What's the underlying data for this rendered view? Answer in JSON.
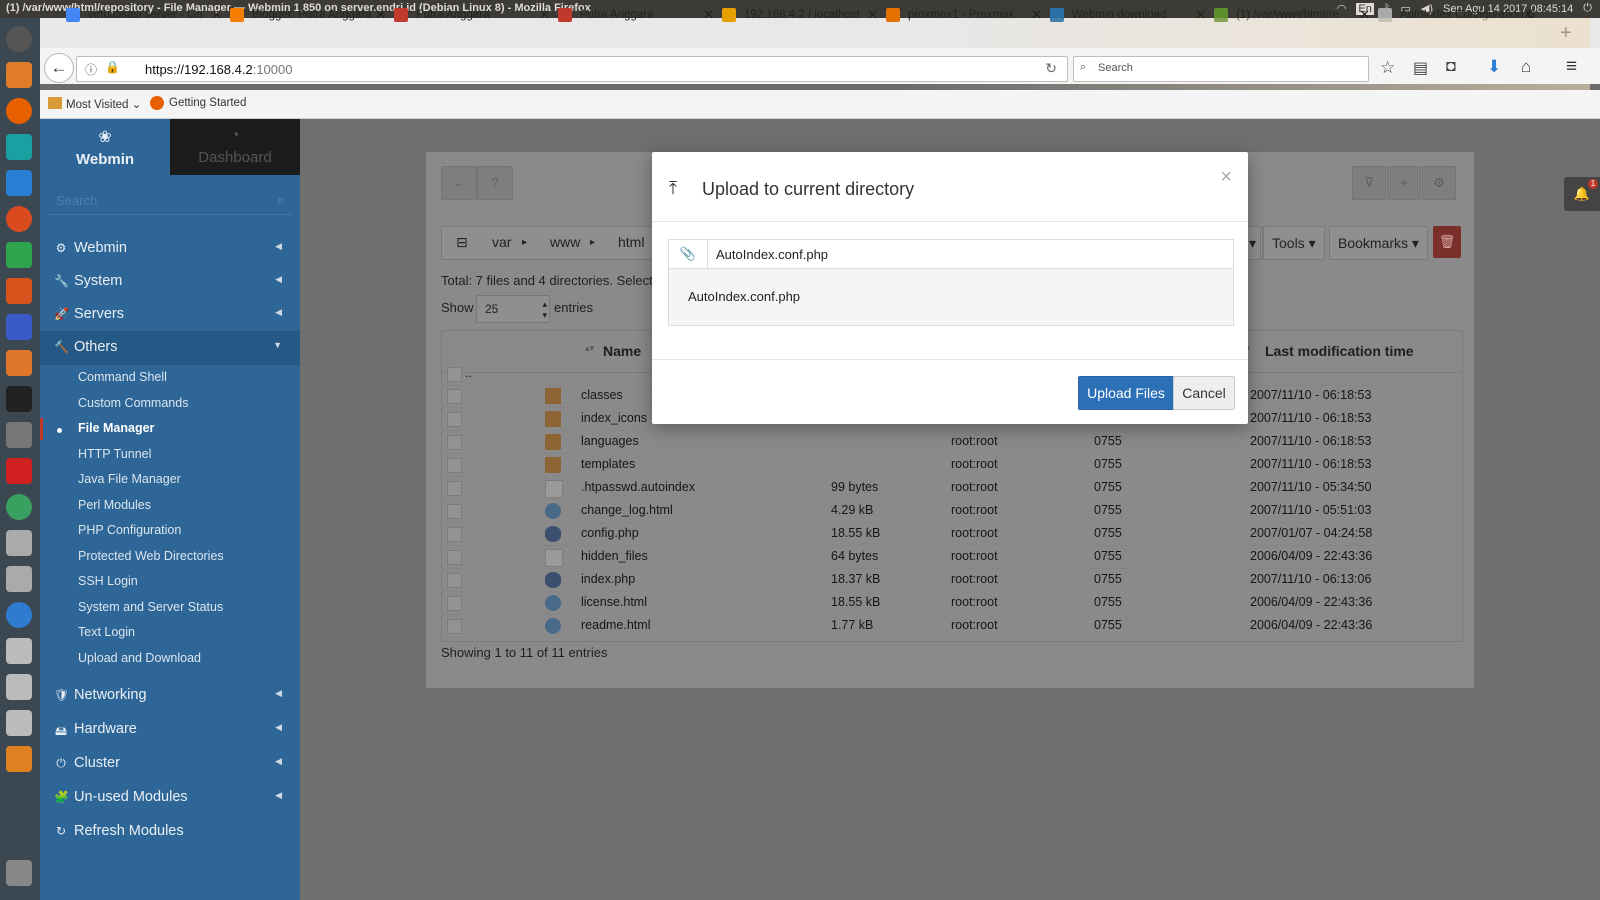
{
  "os": {
    "window_title": "(1) /var/www/html/repository - File Manager — Webmin 1.850 on server.endri.id (Debian Linux 8) - Mozilla Firefox",
    "keyboard": "En",
    "datetime": "Sen Agu 14 2017 08:45:14"
  },
  "browser": {
    "tabs": [
      {
        "label": "virtualisasi server - Go",
        "icon": "google-icon",
        "icolor": "#4285f4"
      },
      {
        "label": "Blogger: Putra Anggara",
        "icon": "blogger-icon",
        "icolor": "#f57d00"
      },
      {
        "label": "Putra Anggara",
        "icon": "putra-icon",
        "icolor": "#c0392b"
      },
      {
        "label": "Putra Anggara",
        "icon": "putra-icon",
        "icolor": "#c0392b"
      },
      {
        "label": "192.168.4.2 / localhost",
        "icon": "pma-icon",
        "icolor": "#e6a000"
      },
      {
        "label": "proxmox1 - Proxmox",
        "icon": "proxmox-icon",
        "icolor": "#e57000"
      },
      {
        "label": "Webmin download",
        "icon": "sf-icon",
        "icolor": "#2970a6"
      },
      {
        "label": "(1) /var/www/html/re",
        "icon": "webmin-icon",
        "icolor": "#5a8f2c"
      },
      {
        "label": "AutoIndex Configuration G",
        "icon": "page-icon",
        "icolor": "#aaa"
      }
    ],
    "url_host": "https://192.168.4.2",
    "url_rest": ":10000",
    "search_placeholder": "Search",
    "bookmarks": [
      "Most Visited",
      "Getting Started"
    ]
  },
  "sidebar": {
    "tab_webmin": "Webmin",
    "tab_dashboard": "Dashboard",
    "search_placeholder": "Search",
    "categories_top": [
      "Webmin",
      "System",
      "Servers",
      "Others"
    ],
    "others_items": [
      "Command Shell",
      "Custom Commands",
      "File Manager",
      "HTTP Tunnel",
      "Java File Manager",
      "Perl Modules",
      "PHP Configuration",
      "Protected Web Directories",
      "SSH Login",
      "System and Server Status",
      "Text Login",
      "Upload and Download"
    ],
    "categories_bottom": [
      "Networking",
      "Hardware",
      "Cluster",
      "Un-used Modules",
      "Refresh Modules"
    ]
  },
  "filemanager": {
    "breadcrumb": [
      "var",
      "www",
      "html"
    ],
    "tools_label": "Tools",
    "bookmarks_label": "Bookmarks",
    "summary": "Total: 7 files and 4 directories. Select",
    "show_label": "Show",
    "entries_value": "25",
    "entries_label": "entries",
    "col_name": "Name",
    "col_time": "Last modification time",
    "parent": "..",
    "rows": [
      {
        "name": "classes",
        "size": "",
        "owner": "",
        "perm": "",
        "time": "2007/11/10 - 06:18:53",
        "type": "folder"
      },
      {
        "name": "index_icons",
        "size": "",
        "owner": "",
        "perm": "",
        "time": "2007/11/10 - 06:18:53",
        "type": "folder"
      },
      {
        "name": "languages",
        "size": "",
        "owner": "root:root",
        "perm": "0755",
        "time": "2007/11/10 - 06:18:53",
        "type": "folder"
      },
      {
        "name": "templates",
        "size": "",
        "owner": "root:root",
        "perm": "0755",
        "time": "2007/11/10 - 06:18:53",
        "type": "folder"
      },
      {
        "name": ".htpasswd.autoindex",
        "size": "99 bytes",
        "owner": "root:root",
        "perm": "0755",
        "time": "2007/11/10 - 05:34:50",
        "type": "doc"
      },
      {
        "name": "change_log.html",
        "size": "4.29 kB",
        "owner": "root:root",
        "perm": "0755",
        "time": "2007/11/10 - 05:51:03",
        "type": "globe"
      },
      {
        "name": "config.php",
        "size": "18.55 kB",
        "owner": "root:root",
        "perm": "0755",
        "time": "2007/01/07 - 04:24:58",
        "type": "php"
      },
      {
        "name": "hidden_files",
        "size": "64 bytes",
        "owner": "root:root",
        "perm": "0755",
        "time": "2006/04/09 - 22:43:36",
        "type": "doc"
      },
      {
        "name": "index.php",
        "size": "18.37 kB",
        "owner": "root:root",
        "perm": "0755",
        "time": "2007/11/10 - 06:13:06",
        "type": "php"
      },
      {
        "name": "license.html",
        "size": "18.55 kB",
        "owner": "root:root",
        "perm": "0755",
        "time": "2006/04/09 - 22:43:36",
        "type": "globe"
      },
      {
        "name": "readme.html",
        "size": "1.77 kB",
        "owner": "root:root",
        "perm": "0755",
        "time": "2006/04/09 - 22:43:36",
        "type": "globe"
      }
    ],
    "footer": "Showing 1 to 11 of 11 entries"
  },
  "modal": {
    "title": "Upload to current directory",
    "file_value": "AutoIndex.conf.php",
    "file_list": "AutoIndex.conf.php",
    "upload_label": "Upload Files",
    "cancel_label": "Cancel"
  },
  "notifications": {
    "count": "1"
  }
}
